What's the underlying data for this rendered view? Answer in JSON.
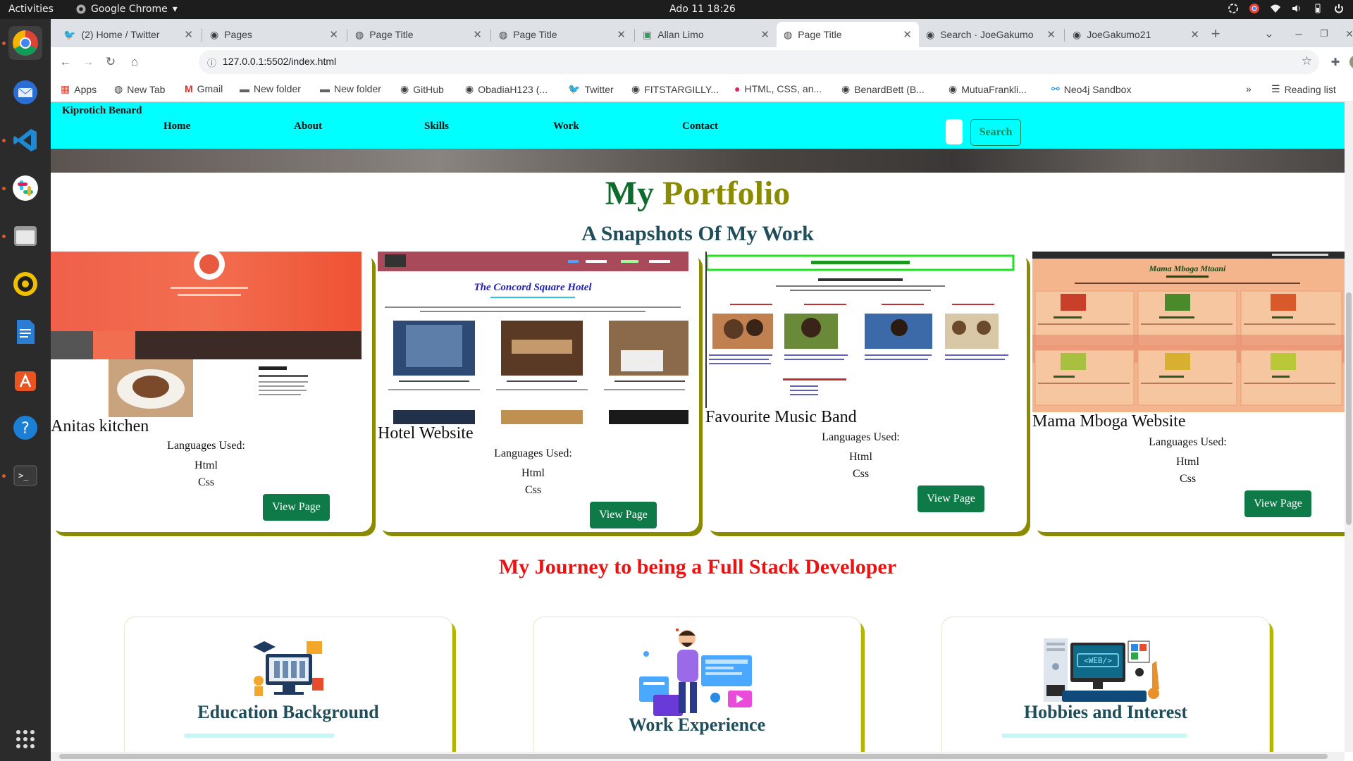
{
  "system": {
    "activities": "Activities",
    "app_name": "Google Chrome",
    "clock": "Ado 11  18:26"
  },
  "browser": {
    "tabs": [
      {
        "label": "(2) Home / Twitter",
        "icon": "twitter-icon"
      },
      {
        "label": "Pages",
        "icon": "github-icon"
      },
      {
        "label": "Page Title",
        "icon": "globe-icon"
      },
      {
        "label": "Page Title",
        "icon": "globe-icon"
      },
      {
        "label": "Allan Limo",
        "icon": "page-icon"
      },
      {
        "label": "Page Title",
        "icon": "globe-icon"
      },
      {
        "label": "Search · JoeGakumo",
        "icon": "github-icon"
      },
      {
        "label": "JoeGakumo21",
        "icon": "github-icon"
      }
    ],
    "url": "127.0.0.1:5502/index.html",
    "bookmarks": [
      {
        "label": "Apps",
        "icon": "apps-grid-icon"
      },
      {
        "label": "New Tab",
        "icon": "globe-icon"
      },
      {
        "label": "Gmail",
        "icon": "gmail-icon"
      },
      {
        "label": "New folder",
        "icon": "folder-icon"
      },
      {
        "label": "New folder",
        "icon": "folder-icon"
      },
      {
        "label": "GitHub",
        "icon": "github-icon"
      },
      {
        "label": "ObadiaH123 (...",
        "icon": "github-icon"
      },
      {
        "label": "Twitter",
        "icon": "twitter-icon"
      },
      {
        "label": "FITSTARGILLY...",
        "icon": "github-icon"
      },
      {
        "label": "HTML, CSS, an...",
        "icon": "red-circle-icon"
      },
      {
        "label": "BenardBett (B...",
        "icon": "github-icon"
      },
      {
        "label": "MutuaFrankli...",
        "icon": "github-icon"
      },
      {
        "label": "Neo4j Sandbox",
        "icon": "neo4j-icon"
      }
    ],
    "reading_list": "Reading list",
    "overflow": "»"
  },
  "site": {
    "brand": "Kiprotich Benard",
    "nav": [
      "Home",
      "About",
      "Skills",
      "Work",
      "Contact"
    ],
    "search_button": "Search",
    "portfolio_title_1": "My",
    "portfolio_title_2": "Portfolio",
    "portfolio_subtitle": "A Snapshots Of My Work",
    "languages_heading": "Languages Used:",
    "view_button": "View Page",
    "projects": [
      {
        "title": "Anitas kitchen",
        "languages": [
          "Html",
          "Css"
        ]
      },
      {
        "title": "Hotel Website",
        "languages": [
          "Html",
          "Css"
        ]
      },
      {
        "title": "Favourite Music Band",
        "languages": [
          "Html",
          "Css"
        ]
      },
      {
        "title": "Mama Mboga Website",
        "languages": [
          "Html",
          "Css"
        ]
      }
    ],
    "journey_title": "My Journey to being a Full Stack Developer",
    "journey": [
      {
        "title": "Education Background"
      },
      {
        "title": "Work Experience"
      },
      {
        "title": "Hobbies and Interest"
      }
    ]
  },
  "colors": {
    "nav_bg": "#00ffff",
    "accent_green": "#0e7a48",
    "card_shadow": "#8b8b00",
    "journey_red": "#ee1111"
  }
}
